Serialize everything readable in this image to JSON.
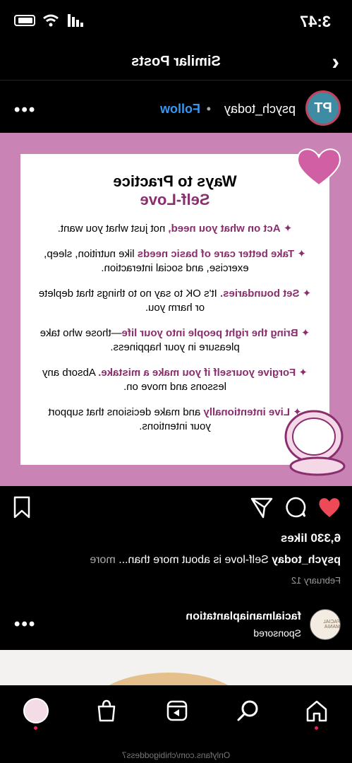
{
  "status": {
    "time": "3:47"
  },
  "nav": {
    "title": "Similar Posts"
  },
  "post": {
    "avatar_initials": "PT",
    "handle": "psych_today",
    "separator": "•",
    "follow_label": "Follow",
    "image": {
      "title": "Ways to Practice",
      "subtitle": "Self-Love",
      "items": [
        {
          "bold": "Act on what you need,",
          "rest": " not just what you want."
        },
        {
          "bold": "Take better care of basic needs",
          "rest": " like nutrition, sleep, exercise, and social interaction."
        },
        {
          "bold": "Set boundaries.",
          "rest": " It's OK to say no to things that deplete or harm you."
        },
        {
          "bold": "Bring the right people into your life",
          "rest": "—those who take pleasure in your happiness."
        },
        {
          "bold": "Forgive yourself if you make a mistake.",
          "rest": " Absorb any lessons and move on."
        },
        {
          "bold": "Live intentionally",
          "rest": " and make decisions that support your intentions."
        }
      ]
    },
    "likes": "6,330 likes",
    "caption_user": "psych_today",
    "caption_text": " Self-love is about more than...",
    "caption_more": " more",
    "date": "February 12"
  },
  "sponsored": {
    "name": "facialmaniaplantation",
    "label": "Sponsored",
    "avatar_text": "FACIAL MANIA"
  },
  "watermark": "Onlyfans.com/chibigoddess7",
  "colors": {
    "accent_pink": "#c983b5",
    "accent_plum": "#8a2e6e",
    "link_blue": "#3897f0",
    "like_red": "#ed4956"
  }
}
